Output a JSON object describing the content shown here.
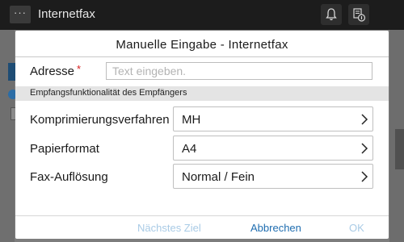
{
  "app": {
    "title": "Internetfax",
    "menu_label": "···",
    "icons": [
      "bell-icon",
      "job-status-icon"
    ]
  },
  "dialog": {
    "title": "Manuelle Eingabe - Internetfax",
    "address": {
      "label": "Adresse",
      "required_mark": "*",
      "placeholder": "Text eingeben.",
      "value": ""
    },
    "section_title": "Empfangsfunktionalität des Empfängers",
    "fields": [
      {
        "label": "Komprimierungsverfahren",
        "value": "MH"
      },
      {
        "label": "Papierformat",
        "value": "A4"
      },
      {
        "label": "Fax-Auflösung",
        "value": "Normal / Fein"
      }
    ],
    "buttons": {
      "next": "Nächstes Ziel",
      "cancel": "Abbrechen",
      "ok": "OK"
    }
  },
  "colors": {
    "required": "#d81e1e",
    "link_active": "#1f6db0",
    "link_disabled": "#a9cbe6",
    "section_bg": "#e4e4e4"
  }
}
